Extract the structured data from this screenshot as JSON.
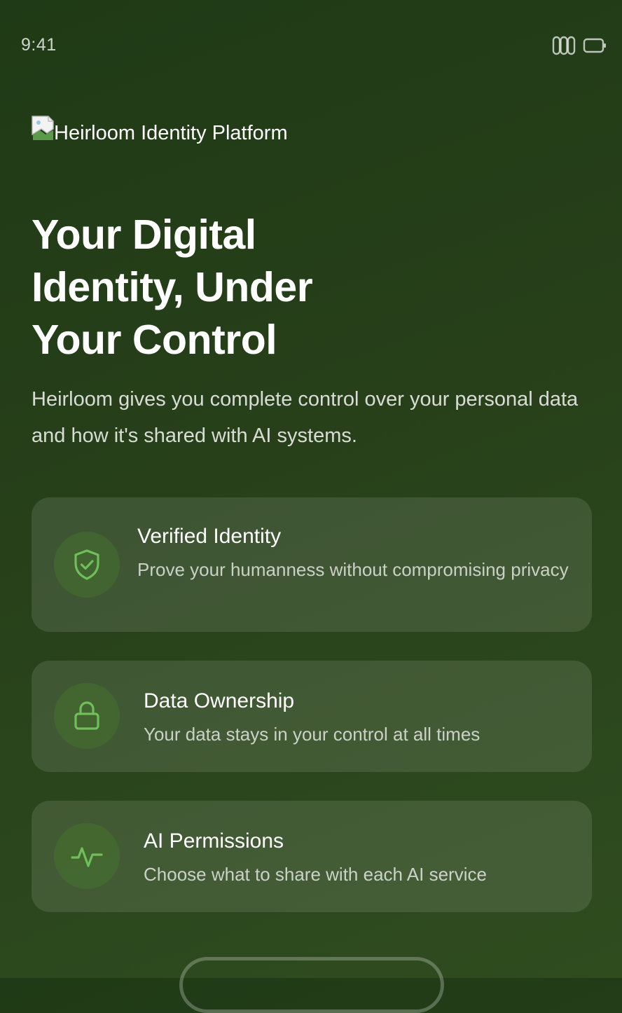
{
  "status_bar": {
    "time": "9:41",
    "icons": [
      "signal-icon",
      "battery-icon"
    ]
  },
  "brand": {
    "image_alt": "Heirloom Identity Platform",
    "icon": "broken-image-icon"
  },
  "hero": {
    "title": "Your Digital\nIdentity, Under\nYour Control",
    "description": "Heirloom gives you complete control over your personal data and how it's shared with AI systems."
  },
  "features": [
    {
      "icon": "shield-check-icon",
      "title": "Verified Identity",
      "description": "Prove your humanness without compromising privacy"
    },
    {
      "icon": "lock-icon",
      "title": "Data Ownership",
      "description": "Your data stays in your control at all times"
    },
    {
      "icon": "activity-icon",
      "title": "AI Permissions",
      "description": "Choose what to share with each AI service"
    }
  ],
  "colors": {
    "background_start": "#1f3a16",
    "background_end": "#2f4c1f",
    "accent_green": "#6fbf5a",
    "icon_bg": "#34562a"
  }
}
